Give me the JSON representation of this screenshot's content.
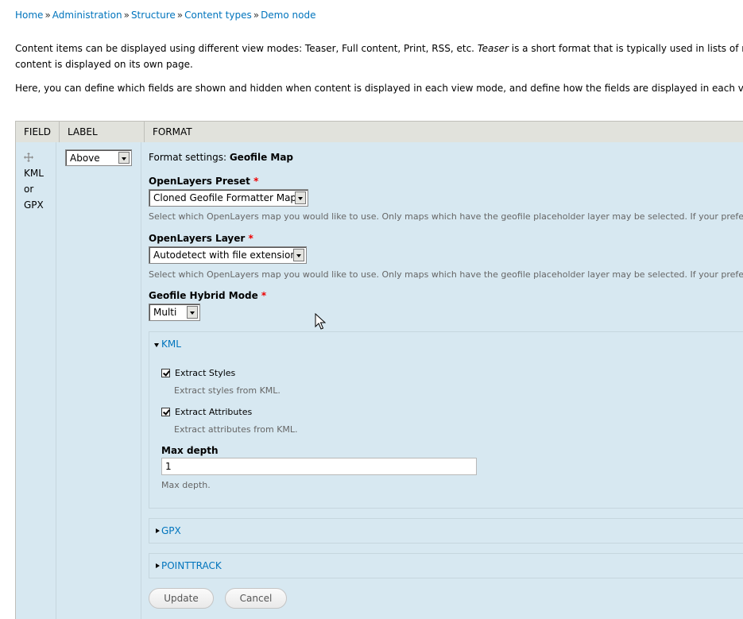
{
  "breadcrumb": {
    "items": [
      "Home",
      "Administration",
      "Structure",
      "Content types",
      "Demo node"
    ],
    "separator": "»"
  },
  "intro": {
    "line1_before": "Content items can be displayed using different view modes: Teaser, Full content, Print, RSS, etc. ",
    "line1_em": "Teaser",
    "line1_after": " is a short format that is typically used in lists of multipl",
    "line2": "content is displayed on its own page.",
    "line3": "Here, you can define which fields are shown and hidden when content is displayed in each view mode, and define how the fields are displayed in each view mo"
  },
  "table": {
    "headers": [
      "Field",
      "Label",
      "Format"
    ]
  },
  "row": {
    "field_lines": [
      "KML",
      "or",
      "GPX"
    ],
    "label_select": "Above"
  },
  "format": {
    "settings_label": "Format settings:",
    "settings_value": "Geofile Map",
    "preset": {
      "label": "OpenLayers Preset",
      "required": "*",
      "value": "Cloned Geofile Formatter Map",
      "desc": "Select which OpenLayers map you would like to use. Only maps which have the geofile placeholder layer may be selected. If your preferred m"
    },
    "layer": {
      "label": "OpenLayers Layer",
      "required": "*",
      "value": "Autodetect with file extension",
      "desc": "Select which OpenLayers map you would like to use. Only maps which have the geofile placeholder layer may be selected. If your preferred m"
    },
    "hybrid": {
      "label": "Geofile Hybrid Mode",
      "required": "*",
      "value": "Multi"
    },
    "kml": {
      "legend": "KML",
      "extract_styles": {
        "label": "Extract Styles",
        "desc": "Extract styles from KML.",
        "checked": true
      },
      "extract_attributes": {
        "label": "Extract Attributes",
        "desc": "Extract attributes from KML.",
        "checked": true
      },
      "max_depth": {
        "label": "Max depth",
        "value": "1",
        "desc": "Max depth."
      }
    },
    "gpx": {
      "legend": "GPX"
    },
    "pointtrack": {
      "legend": "POINTTRACK"
    },
    "update_label": "Update",
    "cancel_label": "Cancel"
  },
  "colors": {
    "link": "#0074bd",
    "row_background": "#d7e8f1",
    "header_background": "#e1e2dc",
    "required": "#ee0000"
  }
}
